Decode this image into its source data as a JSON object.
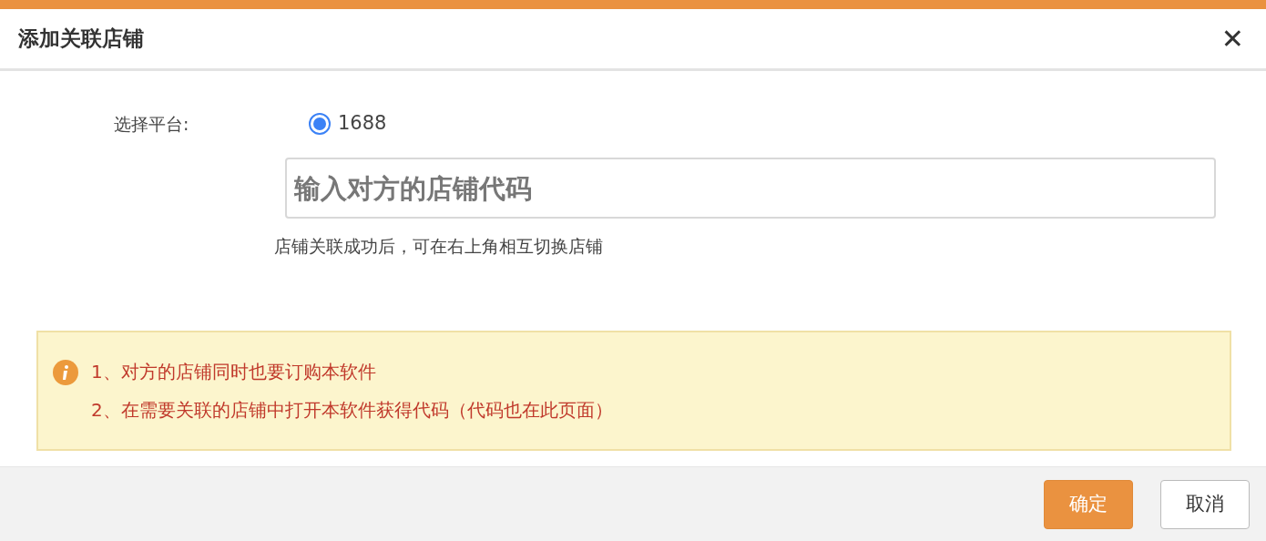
{
  "dialog": {
    "title": "添加关联店铺",
    "close": "✕"
  },
  "platform": {
    "label": "选择平台:",
    "options": [
      {
        "label": "1688",
        "selected": true
      }
    ]
  },
  "shop_code": {
    "placeholder": "输入对方的店铺代码"
  },
  "hint": "店铺关联成功后，可在右上角相互切换店铺",
  "notice": {
    "lines": [
      "1、对方的店铺同时也要订购本软件",
      "2、在需要关联的店铺中打开本软件获得代码（代码也在此页面）"
    ]
  },
  "buttons": [
    {
      "label": "确定",
      "kind": "primary"
    },
    {
      "label": "取消",
      "kind": "secondary"
    }
  ]
}
